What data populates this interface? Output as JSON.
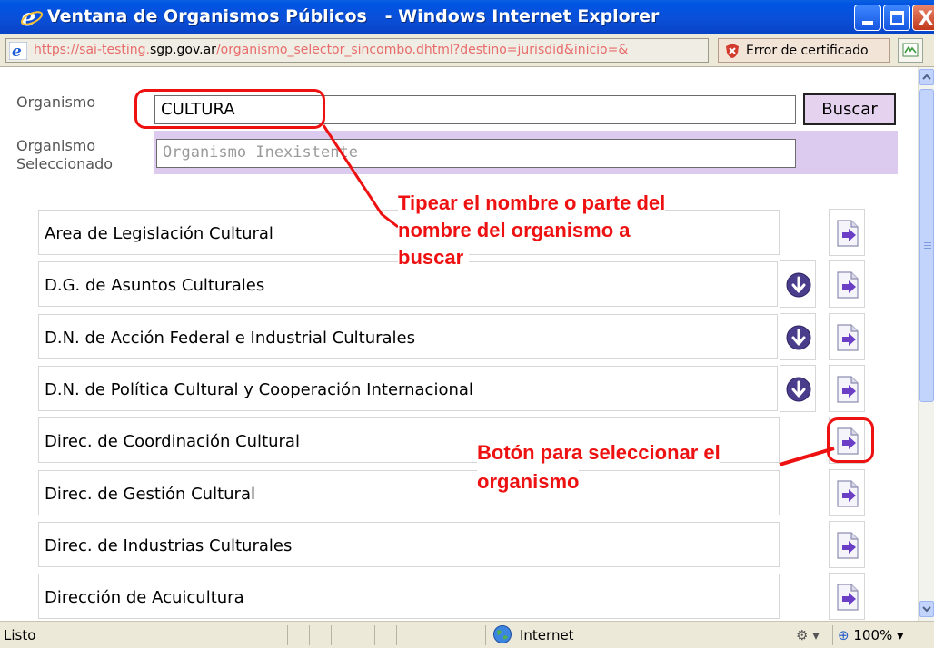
{
  "window": {
    "title": "Ventana de Organismos Públicos   - Windows Internet Explorer",
    "close_glyph": "X"
  },
  "address": {
    "url_prefix": "https://sai-testing.",
    "url_host": "sgp.gov.ar",
    "url_path": "/organismo_selector_sincombo.dhtml?destino=jurisdid&inicio=&",
    "cert_error": "Error de certificado"
  },
  "form": {
    "organismo_label": "Organismo",
    "organismo_value": "CULTURA",
    "buscar_label": "Buscar",
    "seleccionado_label_1": "Organismo",
    "seleccionado_label_2": "Seleccionado",
    "seleccionado_value": "Organismo Inexistente"
  },
  "rows": [
    {
      "label": "Area de Legislación Cultural",
      "has_expand": false
    },
    {
      "label": "D.G. de Asuntos Culturales",
      "has_expand": true
    },
    {
      "label": "D.N. de Acción Federal e Industrial Culturales",
      "has_expand": true
    },
    {
      "label": "D.N. de Política Cultural y Cooperación Internacional",
      "has_expand": true
    },
    {
      "label": "Direc. de Coordinación Cultural",
      "has_expand": false
    },
    {
      "label": "Direc. de Gestión Cultural",
      "has_expand": false
    },
    {
      "label": "Direc. de Industrias Culturales",
      "has_expand": false
    },
    {
      "label": "Dirección de Acuicultura",
      "has_expand": false
    }
  ],
  "annotations": {
    "search_hint_1": "Tipear el nombre o parte del",
    "search_hint_2": "nombre del organismo a",
    "search_hint_3": "buscar",
    "select_hint_1": "Botón para seleccionar el",
    "select_hint_2": "organismo"
  },
  "status": {
    "text": "Listo",
    "zone": "Internet",
    "zoom": "100%"
  },
  "colors": {
    "annotation_red": "#ee1111",
    "selected_band": "#dccbef",
    "titlebar_blue": "#0054e3"
  }
}
